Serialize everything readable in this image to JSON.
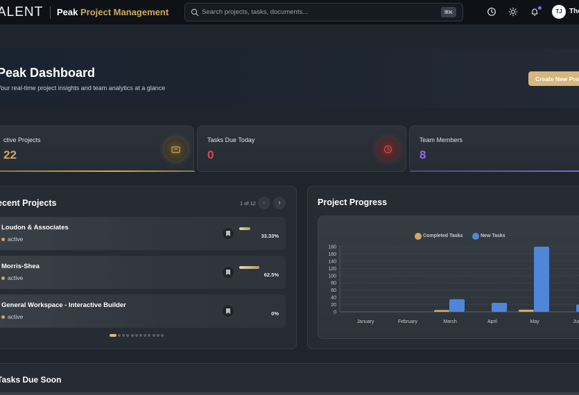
{
  "topbar": {
    "brand": "ALENT",
    "app_title_main": "Peak",
    "app_title_accent": "Project Management",
    "search_placeholder": "Search projects, tasks, documents...",
    "search_shortcut": "⌘K",
    "icons": [
      "clock-icon",
      "sun-icon",
      "bell-icon"
    ],
    "avatar_initials": "TJ",
    "user_name": "Tho"
  },
  "hero": {
    "title": "Peak Dashboard",
    "subtitle": "Your real-time project insights and team analytics at a glance",
    "cta_label": "Create New Pro"
  },
  "stats": [
    {
      "label": "ctive Projects",
      "value": "22",
      "color": "#d2a85f",
      "icon": "folder-icon"
    },
    {
      "label": "Tasks Due Today",
      "value": "0",
      "color": "#e0474c",
      "icon": "clock-icon"
    },
    {
      "label": "Team Members",
      "value": "8",
      "color": "#8b6cf0",
      "icon": "users-icon"
    }
  ],
  "recent_projects": {
    "title": "ecent Projects",
    "pager": "1 of 12",
    "prev": "‹",
    "next": "›",
    "items": [
      {
        "name": "Loudon & Associates",
        "status": "active",
        "progress_label": "33.33%",
        "progress": 0.3333
      },
      {
        "name": "Morris-Shea",
        "status": "active",
        "progress_label": "62.5%",
        "progress": 0.625
      },
      {
        "name": "General Workspace - Interactive Builder",
        "status": "active",
        "progress_label": "0%",
        "progress": 0
      }
    ],
    "pages": 12,
    "current_page": 1
  },
  "project_progress": {
    "title": "Project Progress"
  },
  "chart_data": {
    "type": "bar",
    "categories": [
      "January",
      "February",
      "March",
      "April",
      "May",
      "Jun"
    ],
    "series": [
      {
        "name": "Completed Tasks",
        "color": "#d2a85f",
        "values": [
          0,
          0,
          5,
          0,
          6,
          0
        ]
      },
      {
        "name": "New Tasks",
        "color": "#4f86d8",
        "values": [
          0,
          0,
          35,
          25,
          180,
          20
        ]
      }
    ],
    "ylim": [
      0,
      180
    ],
    "yticks": [
      0,
      20,
      40,
      60,
      80,
      100,
      120,
      140,
      160,
      180
    ],
    "grid": true,
    "legend": "top"
  },
  "tasks_due_soon": {
    "title": "Tasks Due Soon"
  }
}
